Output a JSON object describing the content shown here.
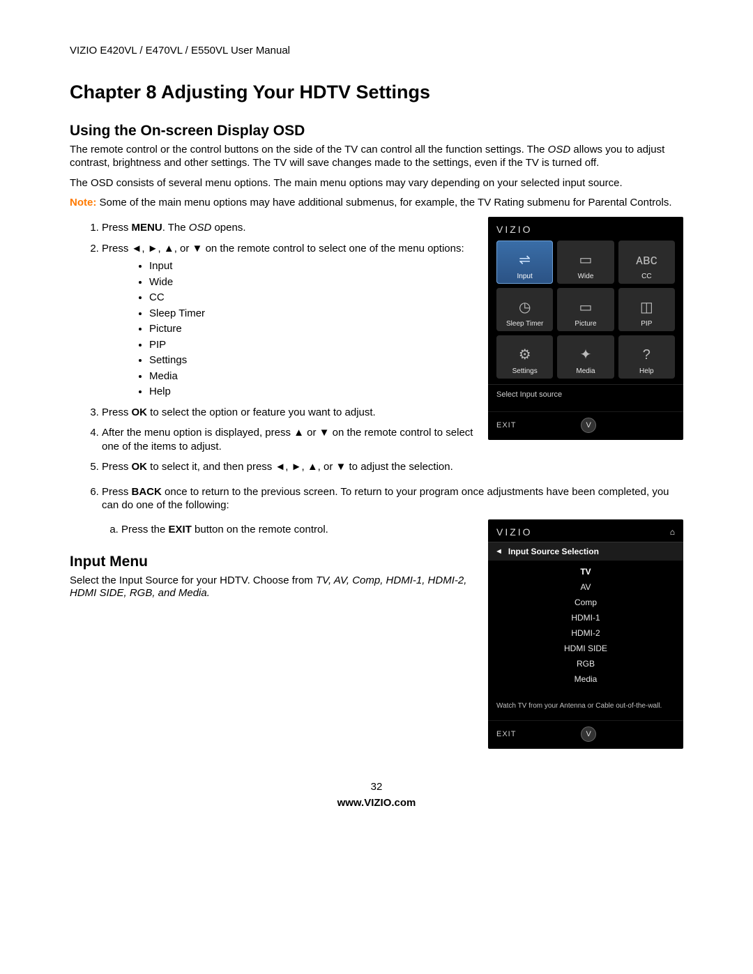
{
  "header": {
    "manual_line": "VIZIO E420VL / E470VL / E550VL User Manual"
  },
  "chapter": {
    "title": "Chapter 8 Adjusting Your HDTV Settings"
  },
  "osd_section": {
    "heading": "Using the On-screen Display OSD",
    "p1_a": "The remote control or the control buttons on the side of the TV can control all the function settings. The ",
    "p1_b": "OSD",
    "p1_c": " allows you to adjust contrast, brightness and other settings. The TV will save changes made to the settings, even if the TV is turned off.",
    "p2": "The OSD consists of several menu options. The main menu options may vary depending on your selected input source.",
    "note_label": "Note:",
    "note_text": "  Some of the main menu options may have additional submenus, for example, the TV Rating submenu for Parental Controls."
  },
  "steps": {
    "s1_a": "Press ",
    "s1_b": "MENU",
    "s1_c": ". The ",
    "s1_d": "OSD",
    "s1_e": " opens.",
    "s2_a": "Press ◄, ►, ▲, or ▼ on the remote control to select one of the menu options:",
    "bullets": [
      "Input",
      "Wide",
      "CC",
      "Sleep Timer",
      "Picture",
      "PIP",
      "Settings",
      "Media",
      "Help"
    ],
    "s3_a": "Press ",
    "s3_b": "OK",
    "s3_c": " to select the option or feature you want to adjust.",
    "s4": "After the menu option is displayed, press ▲ or ▼ on the remote control to select one of the items to adjust.",
    "s5_a": "Press ",
    "s5_b": "OK",
    "s5_c": " to select it, and then press ◄, ►, ▲, or ▼ to adjust the selection.",
    "s6_a": "Press ",
    "s6_b": "BACK",
    "s6_c": " once to return to the previous screen. To return to your program once adjustments have been completed, you can do one of the following:",
    "s6_sub_a": "Press the ",
    "s6_sub_b": "EXIT",
    "s6_sub_c": " button on the remote control."
  },
  "osd1": {
    "brand": "VIZIO",
    "tiles": [
      {
        "label": "Input",
        "sel": true,
        "icon": "⇌"
      },
      {
        "label": "Wide",
        "sel": false,
        "icon": "▭"
      },
      {
        "label": "CC",
        "sel": false,
        "icon": "ᴀʙᴄ"
      },
      {
        "label": "Sleep Timer",
        "sel": false,
        "icon": "◷"
      },
      {
        "label": "Picture",
        "sel": false,
        "icon": "▭"
      },
      {
        "label": "PIP",
        "sel": false,
        "icon": "◫"
      },
      {
        "label": "Settings",
        "sel": false,
        "icon": "⚙"
      },
      {
        "label": "Media",
        "sel": false,
        "icon": "✦"
      },
      {
        "label": "Help",
        "sel": false,
        "icon": "?"
      }
    ],
    "caption": "Select Input source",
    "exit": "EXIT",
    "vbtn": "V"
  },
  "input_section": {
    "heading": "Input Menu",
    "p_a": "Select the Input Source for your HDTV. Choose from ",
    "p_b": "TV, AV, Comp, HDMI-1, HDMI-2, HDMI SIDE, RGB, and Media."
  },
  "osd2": {
    "brand": "VIZIO",
    "home": "⌂",
    "title_arrow": "◄",
    "title": "Input Source Selection",
    "items": [
      "TV",
      "AV",
      "Comp",
      "HDMI-1",
      "HDMI-2",
      "HDMI SIDE",
      "RGB",
      "Media"
    ],
    "selected": "TV",
    "note": "Watch TV from your Antenna or Cable out-of-the-wall.",
    "exit": "EXIT",
    "vbtn": "V"
  },
  "footer": {
    "page_no": "32",
    "url": "www.VIZIO.com"
  }
}
